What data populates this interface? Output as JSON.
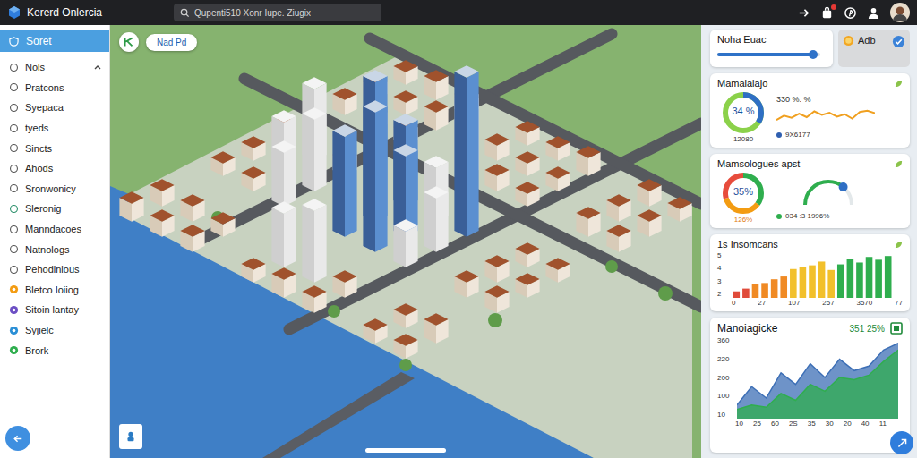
{
  "window": {
    "title": "Kererd Onlercia"
  },
  "search": {
    "placeholder": "Qupenti510 Xonr Iupe. Ziugix"
  },
  "sidebar": {
    "header": {
      "label": "Soret",
      "selected": true
    },
    "items": [
      {
        "label": "Nols",
        "expanded": true,
        "selected": false,
        "kind": "outline",
        "color": "#555555"
      },
      {
        "label": "Pratcons",
        "expanded": false,
        "selected": false,
        "kind": "outline",
        "color": "#555555"
      },
      {
        "label": "Syepaca",
        "expanded": false,
        "selected": false,
        "kind": "outline",
        "color": "#555555"
      },
      {
        "label": "tyeds",
        "expanded": false,
        "selected": false,
        "kind": "outline",
        "color": "#555555"
      },
      {
        "label": "Sincts",
        "expanded": false,
        "selected": false,
        "kind": "outline",
        "color": "#555555"
      },
      {
        "label": "Ahods",
        "expanded": false,
        "selected": false,
        "kind": "outline",
        "color": "#555555"
      },
      {
        "label": "Sronwonicy",
        "expanded": false,
        "selected": false,
        "kind": "outline",
        "color": "#555555"
      },
      {
        "label": "Sleronig",
        "expanded": false,
        "selected": false,
        "kind": "outline",
        "color": "#2a8f6a"
      },
      {
        "label": "Manndacoes",
        "expanded": false,
        "selected": false,
        "kind": "outline",
        "color": "#555555"
      },
      {
        "label": "Natnologs",
        "expanded": false,
        "selected": false,
        "kind": "outline",
        "color": "#555555"
      },
      {
        "label": "Pehodinious",
        "expanded": false,
        "selected": false,
        "kind": "outline",
        "color": "#555555"
      },
      {
        "label": "Bletco Ioiiog",
        "expanded": false,
        "selected": false,
        "kind": "filled",
        "color": "#f39c12"
      },
      {
        "label": "Sitoin lantay",
        "expanded": false,
        "selected": false,
        "kind": "filled",
        "color": "#6c4fc4"
      },
      {
        "label": "Syjielc",
        "expanded": false,
        "selected": false,
        "kind": "filled",
        "color": "#2a8fd6"
      },
      {
        "label": "Brork",
        "expanded": false,
        "selected": false,
        "kind": "filled",
        "color": "#2fae4e"
      }
    ]
  },
  "map": {
    "badge": {
      "label": "Nad Pd"
    }
  },
  "control_card": {
    "title": "Noha Euac",
    "level": 0.93,
    "side": {
      "label": "Adb"
    }
  },
  "gauge_card": {
    "title": "Mamalalajo",
    "gauge": {
      "level": 0.34,
      "reading": "34 %",
      "caption": "12080"
    },
    "trend": {
      "reading": "330 %. %",
      "values": [
        30,
        45,
        38,
        52,
        40,
        60,
        48,
        55,
        42,
        50,
        35,
        58,
        62,
        54
      ],
      "legend": "9X6177"
    }
  },
  "donut_card": {
    "title": "Mamsologues apst",
    "donut": {
      "reading": "35%",
      "caption": "126%",
      "segments": [
        {
          "level": 0.35,
          "color": "#2fae4e"
        },
        {
          "level": 0.35,
          "color": "#f39c12"
        },
        {
          "level": 0.3,
          "color": "#e74c3c"
        }
      ]
    },
    "arc": {
      "level": 0.72,
      "legend": "034 :3 1996%"
    }
  },
  "bar_card": {
    "title": "1s Insomcans",
    "y_ticks": [
      "5",
      "4",
      "3",
      "2"
    ],
    "x_ticks": [
      "0",
      "27",
      "107",
      "257",
      "3570",
      "77"
    ],
    "bars": [
      {
        "value": 0.7,
        "color": "#e04b3a"
      },
      {
        "value": 1.0,
        "color": "#e04b3a"
      },
      {
        "value": 1.5,
        "color": "#f08a24"
      },
      {
        "value": 1.6,
        "color": "#f08a24"
      },
      {
        "value": 2.0,
        "color": "#f08a24"
      },
      {
        "value": 2.3,
        "color": "#f08a24"
      },
      {
        "value": 3.1,
        "color": "#f2c02b"
      },
      {
        "value": 3.3,
        "color": "#f2c02b"
      },
      {
        "value": 3.5,
        "color": "#f2c02b"
      },
      {
        "value": 3.9,
        "color": "#f2c02b"
      },
      {
        "value": 3.0,
        "color": "#f2c02b"
      },
      {
        "value": 3.6,
        "color": "#2fae4e"
      },
      {
        "value": 4.2,
        "color": "#2fae4e"
      },
      {
        "value": 3.8,
        "color": "#2fae4e"
      },
      {
        "value": 4.4,
        "color": "#2fae4e"
      },
      {
        "value": 4.1,
        "color": "#2fae4e"
      },
      {
        "value": 4.5,
        "color": "#2fae4e"
      }
    ]
  },
  "area_card": {
    "title": "Manoiagicke",
    "reading": "351 25%",
    "y_ticks": [
      "360",
      "220",
      "200",
      "100",
      "10"
    ],
    "x_ticks": [
      "10",
      "25",
      "60",
      "2S",
      "35",
      "30",
      "20",
      "40",
      "11"
    ],
    "series": [
      {
        "color": "#3d6fb6",
        "values": [
          60,
          140,
          90,
          200,
          150,
          240,
          180,
          260,
          210,
          230,
          300,
          330
        ]
      },
      {
        "color": "#2fae4e",
        "values": [
          40,
          60,
          50,
          110,
          80,
          150,
          120,
          180,
          170,
          190,
          250,
          300
        ]
      }
    ]
  }
}
